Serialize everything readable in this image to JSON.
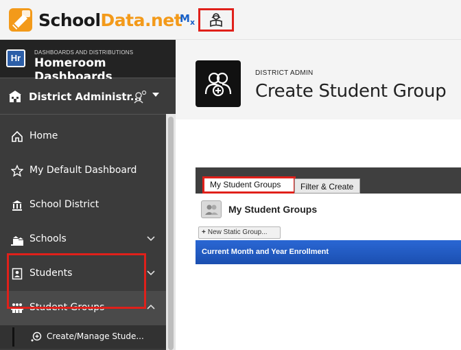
{
  "topbar": {
    "logo_school": "School",
    "logo_data": "Data",
    "logo_net": ".net",
    "mx_label": "M",
    "mx_sub": "x",
    "tool_icon": "reader-icon"
  },
  "sidebar": {
    "section_small": "DASHBOARDS AND DISTRIBUTIONS",
    "section_title": "Homeroom Dashboards",
    "badge": "Hr",
    "district_label": "District Administr...",
    "items": [
      {
        "label": "Home",
        "icon": "home-icon"
      },
      {
        "label": "My Default Dashboard",
        "icon": "star-icon"
      },
      {
        "label": "School District",
        "icon": "building-icon"
      },
      {
        "label": "Schools",
        "icon": "schools-icon"
      },
      {
        "label": "Students",
        "icon": "student-icon"
      },
      {
        "label": "Student Groups",
        "icon": "group-icon"
      }
    ],
    "sub_item": "Create/Manage Stude..."
  },
  "header": {
    "breadcrumb": "DISTRICT ADMIN",
    "title": "Create Student Group"
  },
  "panel": {
    "tabs": [
      "My Student Groups",
      "Filter & Create"
    ],
    "group_title": "My Student Groups",
    "new_button": "New Static Group...",
    "enroll_bar": "Current Month and Year Enrollment"
  },
  "colors": {
    "accent_red": "#e0201a",
    "brand_orange": "#f39a1a",
    "sidebar_bg": "#3b3b3b",
    "enroll_blue": "#2a67d4"
  }
}
